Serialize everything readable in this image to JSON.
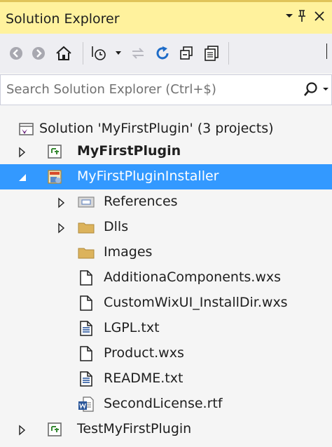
{
  "panel": {
    "title": "Solution Explorer",
    "pin_glyph": "   ",
    "dropdown_glyph": "▾",
    "pin": "I",
    "close": "✕"
  },
  "search": {
    "placeholder": "Search Solution Explorer (Ctrl+$)"
  },
  "tree": {
    "solution": "Solution 'MyFirstPlugin' (3 projects)",
    "items": [
      {
        "label": "MyFirstPlugin"
      },
      {
        "label": "MyFirstPluginInstaller"
      },
      {
        "label": "References"
      },
      {
        "label": "Dlls"
      },
      {
        "label": "Images"
      },
      {
        "label": "AdditionaComponents.wxs"
      },
      {
        "label": "CustomWixUI_InstallDir.wxs"
      },
      {
        "label": "LGPL.txt"
      },
      {
        "label": "Product.wxs"
      },
      {
        "label": "README.txt"
      },
      {
        "label": "SecondLicense.rtf"
      },
      {
        "label": "TestMyFirstPlugin"
      }
    ]
  },
  "colors": {
    "selection": "#3399ff",
    "titlebar": "#fff29d",
    "folder": "#dcb35c"
  }
}
